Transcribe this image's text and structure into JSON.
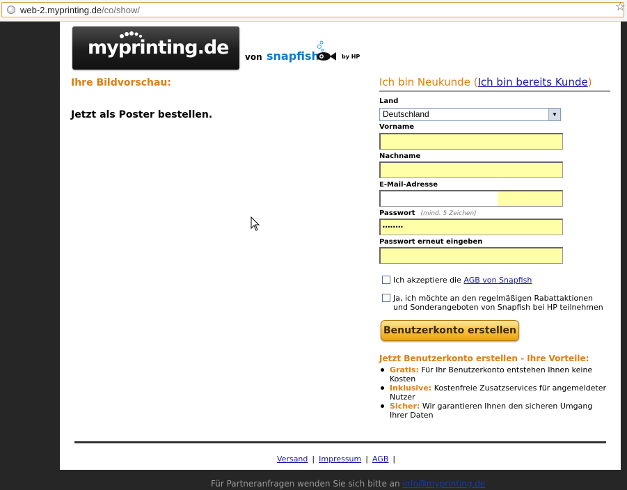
{
  "browser": {
    "url_host": "web-2.myprinting.de",
    "url_path": "/co/show/"
  },
  "header": {
    "logo_text": "myprinting.de",
    "von": "von",
    "partner_name": "snapfish",
    "by_hp": "by HP"
  },
  "left": {
    "title": "Ihre Bildvorschau:",
    "message": "Jetzt als Poster bestellen."
  },
  "form": {
    "heading": "Ich bin Neukunde",
    "heading_link": "Ich bin bereits Kunde",
    "country_label": "Land",
    "country_value": "Deutschland",
    "firstname_label": "Vorname",
    "lastname_label": "Nachname",
    "email_label": "E-Mail-Adresse",
    "password_label": "Passwort",
    "password_hint": "(mind. 5 Zeichen)",
    "password_value": "••••••••",
    "password_repeat_label": "Passwort erneut eingeben",
    "agb_text": "Ich akzeptiere die",
    "agb_link": "AGB von Snapfish",
    "newsletter_text_1": "Ja, ich möchte an den regelmäßigen Rabattaktionen",
    "newsletter_text_2": "und Sonderangeboten von Snapfish bei HP teilnehmen",
    "submit_label": "Benutzerkonto erstellen"
  },
  "advantages": {
    "title": "Jetzt Benutzerkonto erstellen - Ihre Vorteile:",
    "items": [
      {
        "keyword": "Gratis:",
        "text": "Für Ihr Benutzerkonto entstehen Ihnen keine Kosten"
      },
      {
        "keyword": "Inklusive:",
        "text": "Kostenfreie Zusatzservices für angemeldeter Nutzer"
      },
      {
        "keyword": "Sicher:",
        "text": "Wir garantieren Ihnen den sicheren Umgang Ihrer Daten"
      }
    ]
  },
  "footer": {
    "links": [
      "Versand",
      "Impressum",
      "AGB"
    ],
    "partner_text": "Für Partneranfragen wenden Sie sich bitte an",
    "partner_email": "info@myprinting.de"
  },
  "colors": {
    "accent_orange": "#e07d10",
    "link_blue": "#1a1aa6",
    "input_yellow": "#ffffa8"
  }
}
